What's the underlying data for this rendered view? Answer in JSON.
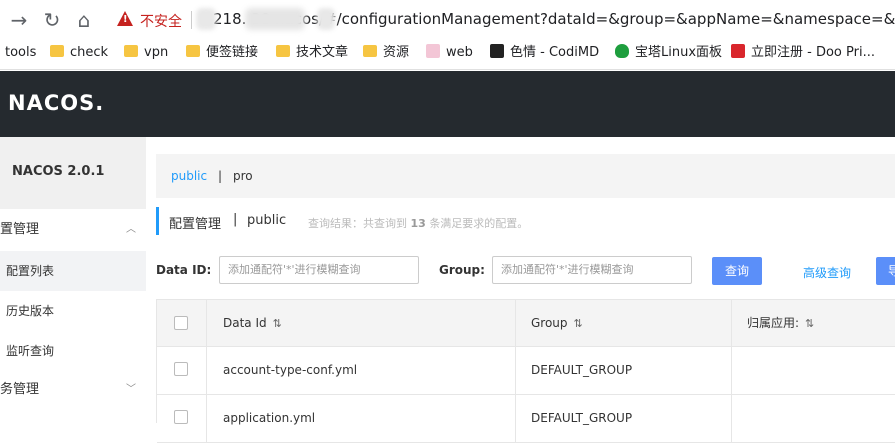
{
  "browser": {
    "insecure_label": "不安全",
    "url_visible": "218.     38   nacos/#/configurationManagement?dataId=&group=&appName=&namespace=&",
    "bookmarks": [
      "tools",
      "check",
      "vpn",
      "便签链接",
      "技术文章",
      "资源",
      "web",
      "色情 - CodiMD",
      "宝塔Linux面板",
      "立即注册 - Doo Pri..."
    ]
  },
  "header": {
    "logo": "NACOS."
  },
  "sidebar": {
    "version": "NACOS 2.0.1",
    "group1": "置管理",
    "items": [
      "配置列表",
      "历史版本",
      "监听查询"
    ],
    "group2": "务管理"
  },
  "namespaces": {
    "active": "public",
    "separator": "|",
    "other": "pro"
  },
  "page": {
    "title": "配置管理",
    "title_sep": "|",
    "title_ns": "public",
    "result_prefix": "查询结果：共查询到",
    "result_count": "13",
    "result_suffix": "条满足要求的配置。"
  },
  "search": {
    "dataid_label": "Data ID:",
    "dataid_placeholder": "添加通配符'*'进行模糊查询",
    "group_label": "Group:",
    "group_placeholder": "添加通配符'*'进行模糊查询",
    "query_button": "查询",
    "advanced_button": "高级查询",
    "more_button": "导"
  },
  "table": {
    "headers": [
      "Data Id",
      "Group",
      "归属应用:"
    ],
    "sort_glyph": "⇅",
    "rows": [
      {
        "data_id": "account-type-conf.yml",
        "group": "DEFAULT_GROUP",
        "app": ""
      },
      {
        "data_id": "application.yml",
        "group": "DEFAULT_GROUP",
        "app": ""
      }
    ]
  },
  "colors": {
    "accent": "#209bfa",
    "button": "#5b8ff9",
    "header_bg": "#252a2f",
    "warning": "#c5221f"
  }
}
